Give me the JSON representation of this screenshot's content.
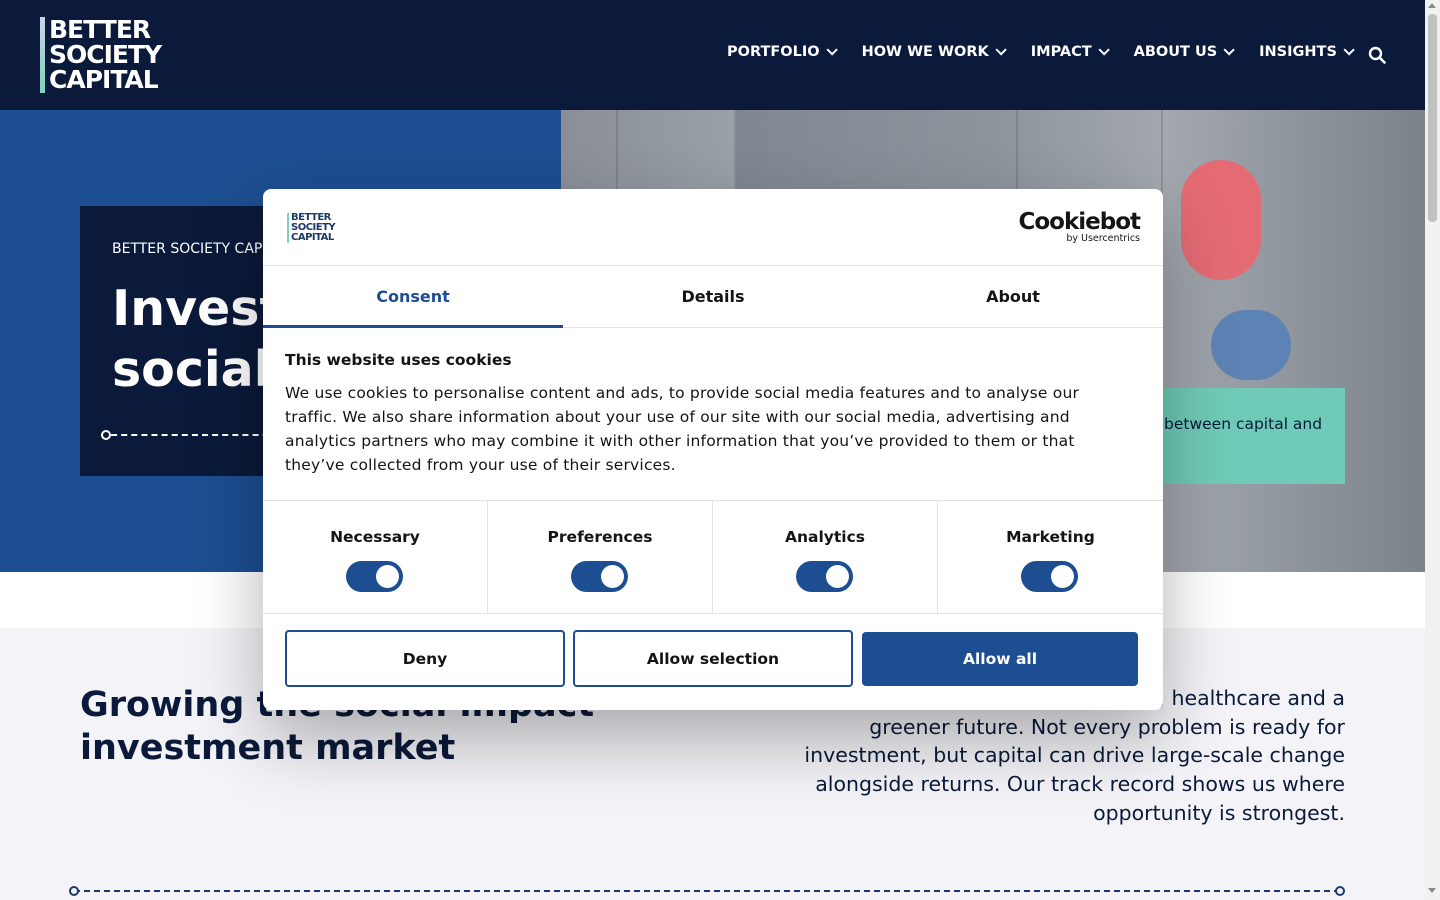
{
  "brand": {
    "logo_lines": [
      "BETTER",
      "SOCIETY",
      "CAPITAL"
    ]
  },
  "nav": {
    "items": [
      "PORTFOLIO",
      "HOW WE WORK",
      "IMPACT",
      "ABOUT US",
      "INSIGHTS"
    ],
    "search_icon": "search-icon"
  },
  "hero": {
    "eyebrow": "BETTER SOCIETY CAPITAL",
    "title": "Invest\nsocial",
    "teal_text": "between capital and"
  },
  "section": {
    "title": "Growing the social impact\ninvestment market",
    "paragraph": "arriers to housing, employment, healthcare and a greener future. Not every problem is ready for investment, but capital can drive large-scale change alongside returns. Our track record shows us where opportunity is strongest."
  },
  "cookie_dialog": {
    "provider": "Cookiebot",
    "provider_by": "by Usercentrics",
    "tabs": [
      "Consent",
      "Details",
      "About"
    ],
    "active_tab": "Consent",
    "heading": "This website uses cookies",
    "body": "We use cookies to personalise content and ads, to provide social media features and to analyse our traffic. We also share information about your use of our site with our social media, advertising and analytics partners who may combine it with other information that you’ve provided to them or that they’ve collected from your use of their services.",
    "preferences": [
      {
        "label": "Necessary",
        "enabled": true
      },
      {
        "label": "Preferences",
        "enabled": true
      },
      {
        "label": "Analytics",
        "enabled": true
      },
      {
        "label": "Marketing",
        "enabled": true
      }
    ],
    "buttons": {
      "deny": "Deny",
      "allow_selection": "Allow selection",
      "allow_all": "Allow all"
    },
    "accent_color": "#1d4e91"
  },
  "colors": {
    "navy": "#0b1a3a",
    "blue": "#1d4e91",
    "teal": "#6fcbb7"
  }
}
